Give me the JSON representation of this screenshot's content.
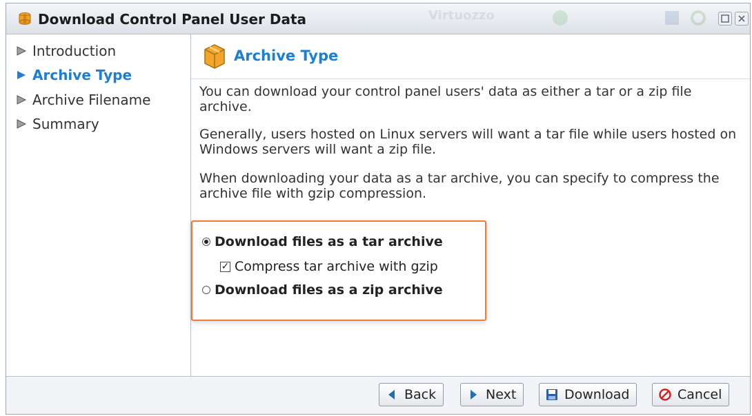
{
  "window": {
    "title": "Download Control Panel User Data",
    "watermark": "Virtuozzo"
  },
  "nav": {
    "items": [
      {
        "label": "Introduction",
        "active": false
      },
      {
        "label": "Archive Type",
        "active": true
      },
      {
        "label": "Archive Filename",
        "active": false
      },
      {
        "label": "Summary",
        "active": false
      }
    ]
  },
  "content": {
    "title": "Archive Type",
    "paragraphs": [
      "You can download your control panel users' data as either a tar or a zip file archive.",
      "Generally, users hosted on Linux servers will want a tar file while users hosted on Windows servers will want a zip file.",
      "When downloading your data as a tar archive, you can specify to compress the archive file with gzip compression."
    ],
    "options": {
      "tar_label": "Download files as a tar archive",
      "tar_selected": true,
      "gzip_label": "Compress tar archive with gzip",
      "gzip_checked": true,
      "zip_label": "Download files as a zip archive",
      "zip_selected": false
    }
  },
  "footer": {
    "back_label": "Back",
    "next_label": "Next",
    "download_label": "Download",
    "cancel_label": "Cancel"
  },
  "colors": {
    "accent": "#1a7fd6",
    "highlight_border": "#f07a3a"
  }
}
